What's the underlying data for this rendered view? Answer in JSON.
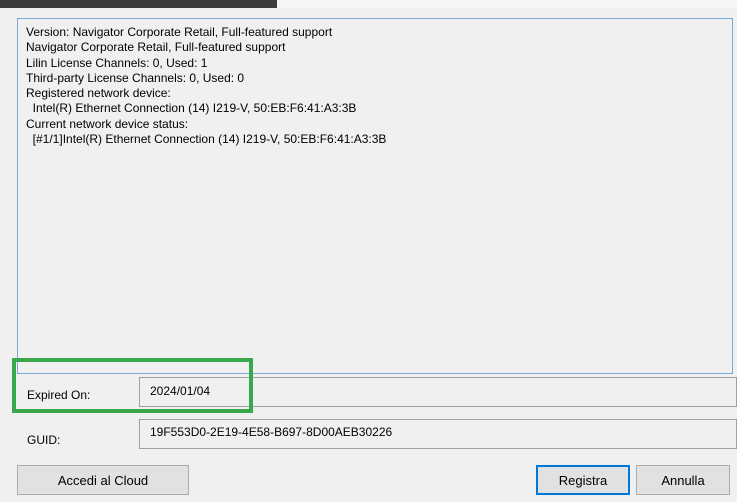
{
  "info": {
    "lines": [
      "Version: Navigator Corporate Retail, Full-featured support",
      "Navigator Corporate Retail, Full-featured support",
      "Lilin License Channels: 0, Used: 1",
      "Third-party License Channels: 0, Used: 0",
      "Registered network device:",
      "  Intel(R) Ethernet Connection (14) I219-V, 50:EB:F6:41:A3:3B",
      "Current network device status:",
      "  [#1/1]Intel(R) Ethernet Connection (14) I219-V, 50:EB:F6:41:A3:3B"
    ]
  },
  "expired": {
    "label": "Expired On:",
    "value": "2024/01/04"
  },
  "guid": {
    "label": "GUID:",
    "value": "19F553D0-2E19-4E58-B697-8D00AEB30226"
  },
  "buttons": {
    "cloud": "Accedi al Cloud",
    "register": "Registra",
    "cancel": "Annulla"
  },
  "colors": {
    "highlight": "#3aa84a",
    "focus_border": "#0078d7"
  }
}
